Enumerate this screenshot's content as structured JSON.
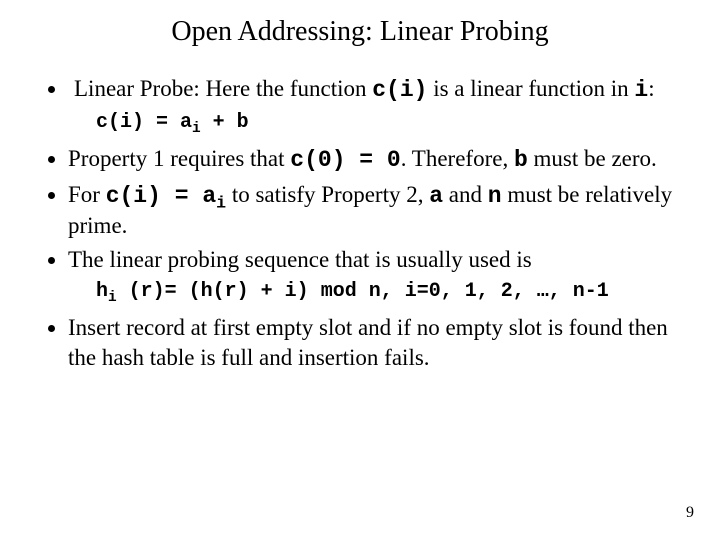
{
  "title": "Open Addressing: Linear Probing",
  "b1_a": "Linear Probe: Here the function ",
  "b1_code": "c(i)",
  "b1_b": " is a linear function in ",
  "b1_code2": "i",
  "b1_c": ":",
  "code1_a": "c(i) = a",
  "code1_sub": "i",
  "code1_b": " + b",
  "b2_a": "Property 1 requires that ",
  "b2_code1": "c(0) = 0",
  "b2_b": ". Therefore, ",
  "b2_code2": "b",
  "b2_c": " must be zero.",
  "b3_a": "For ",
  "b3_code1": "c(i) = a",
  "b3_sub": "i",
  "b3_b": " to satisfy Property 2, ",
  "b3_code2": "a",
  "b3_c": " and ",
  "b3_code3": "n",
  "b3_d": " must be relatively prime.",
  "b4": "The linear probing sequence that is usually used is",
  "code2_a": "h",
  "code2_sub": "i",
  "code2_b": " (r)= (h(r) + i) mod n, i=0, 1, 2, …, n-1",
  "b5": "Insert record at first empty slot and if no empty slot is found  then the hash table is full and insertion fails.",
  "page": "9"
}
